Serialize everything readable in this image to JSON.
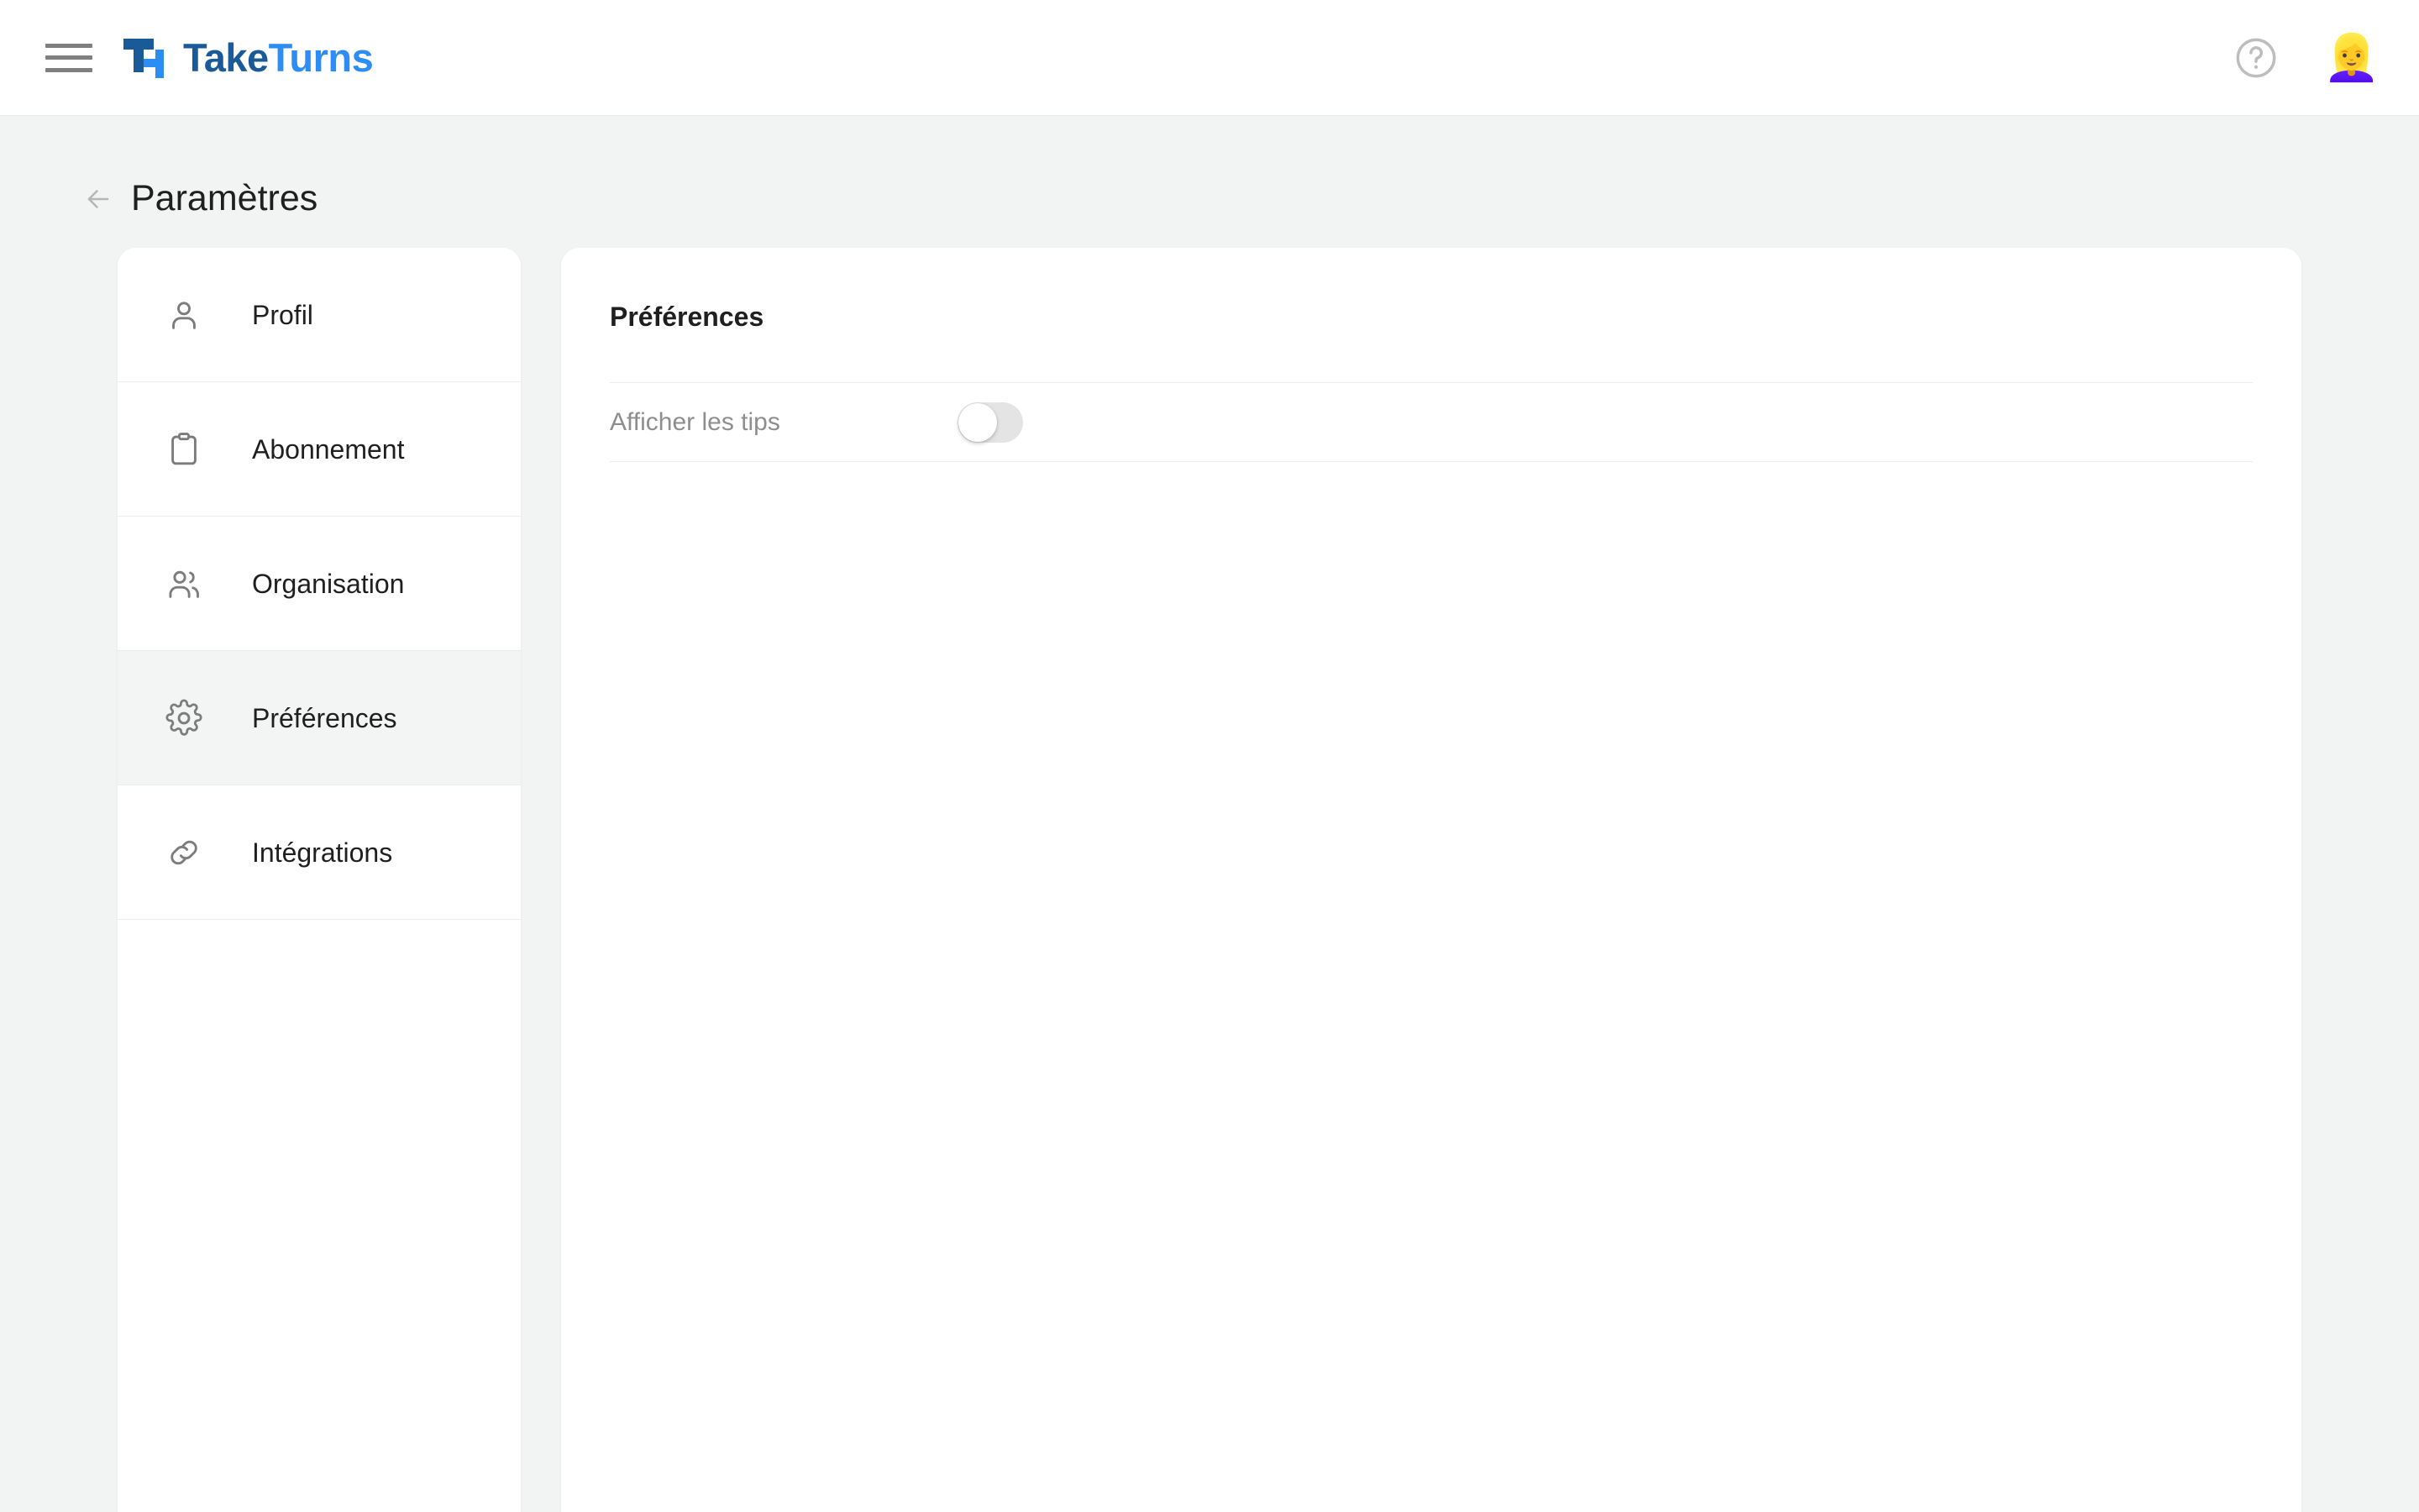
{
  "header": {
    "menu_icon": "hamburger-menu-icon",
    "brand_name_part1": "Take",
    "brand_name_part2": "Turns",
    "help_icon": "question-mark-circle-icon",
    "avatar_emoji": "👱‍♀️",
    "brand_color_dark": "#1b5a99",
    "brand_color_light": "#2c8ef4"
  },
  "page": {
    "back_icon": "arrow-left-icon",
    "title": "Paramètres"
  },
  "sidebar": {
    "items": [
      {
        "label": "Profil",
        "icon": "user-icon",
        "active": false
      },
      {
        "label": "Abonnement",
        "icon": "clipboard-icon",
        "active": false
      },
      {
        "label": "Organisation",
        "icon": "users-icon",
        "active": false
      },
      {
        "label": "Préférences",
        "icon": "gear-icon",
        "active": true
      },
      {
        "label": "Intégrations",
        "icon": "link-icon",
        "active": false
      }
    ]
  },
  "panel": {
    "title": "Préférences",
    "preferences": [
      {
        "label": "Afficher les tips",
        "control": "toggle-switch",
        "enabled": false
      }
    ]
  },
  "colors": {
    "page_background": "#f2f4f4",
    "card_background": "#ffffff",
    "active_nav_background": "#f3f4f4",
    "divider": "#ececec",
    "muted_text": "#8e8e8e"
  }
}
